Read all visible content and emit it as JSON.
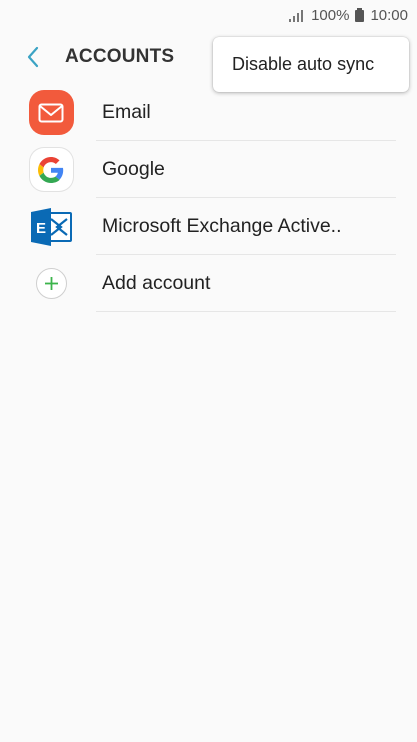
{
  "status_bar": {
    "battery_percent": "100%",
    "time": "10:00"
  },
  "header": {
    "title": "ACCOUNTS"
  },
  "menu": {
    "items": [
      {
        "label": "Disable auto sync"
      }
    ]
  },
  "accounts": [
    {
      "label": "Email",
      "icon": "email-icon"
    },
    {
      "label": "Google",
      "icon": "google-icon"
    },
    {
      "label": "Microsoft Exchange Active..",
      "icon": "exchange-icon"
    }
  ],
  "add_account": {
    "label": "Add account",
    "icon": "add-icon"
  },
  "colors": {
    "accent": "#3ba3c4",
    "email": "#f25a3c",
    "exchange": "#0a6ab5",
    "add": "#3cb44b",
    "background": "#fafafa"
  }
}
